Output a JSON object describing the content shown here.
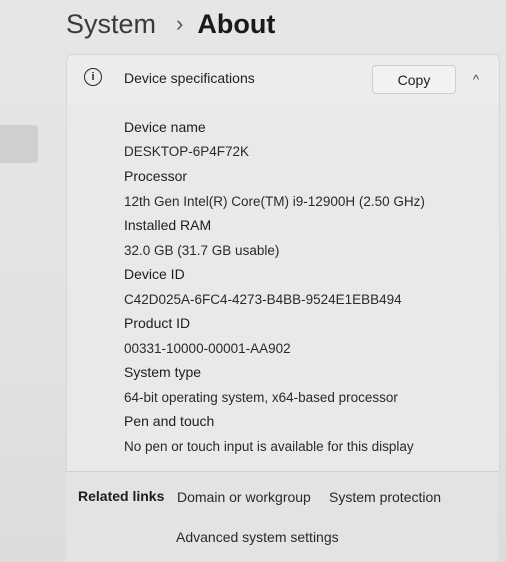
{
  "breadcrumb": {
    "parent": "System",
    "separator": "›",
    "current": "About"
  },
  "card": {
    "info_icon": "info-icon",
    "title": "Device specifications",
    "copy_label": "Copy",
    "collapse_icon": "chevron-up-icon",
    "collapse_glyph": "^"
  },
  "specs": [
    {
      "label": "Device name",
      "value": "DESKTOP-6P4F72K"
    },
    {
      "label": "Processor",
      "value": "12th Gen Intel(R) Core(TM) i9-12900H (2.50 GHz)"
    },
    {
      "label": "Installed RAM",
      "value": "32.0 GB (31.7 GB usable)"
    },
    {
      "label": "Device ID",
      "value": "C42D025A-6FC4-4273-B4BB-9524E1EBB494"
    },
    {
      "label": "Product ID",
      "value": "00331-10000-00001-AA902"
    },
    {
      "label": "System type",
      "value": "64-bit operating system, x64-based processor"
    },
    {
      "label": "Pen and touch",
      "value": "No pen or touch input is available for this display"
    }
  ],
  "related": {
    "title": "Related links",
    "links": [
      "Domain or workgroup",
      "System protection",
      "Advanced system settings"
    ]
  }
}
